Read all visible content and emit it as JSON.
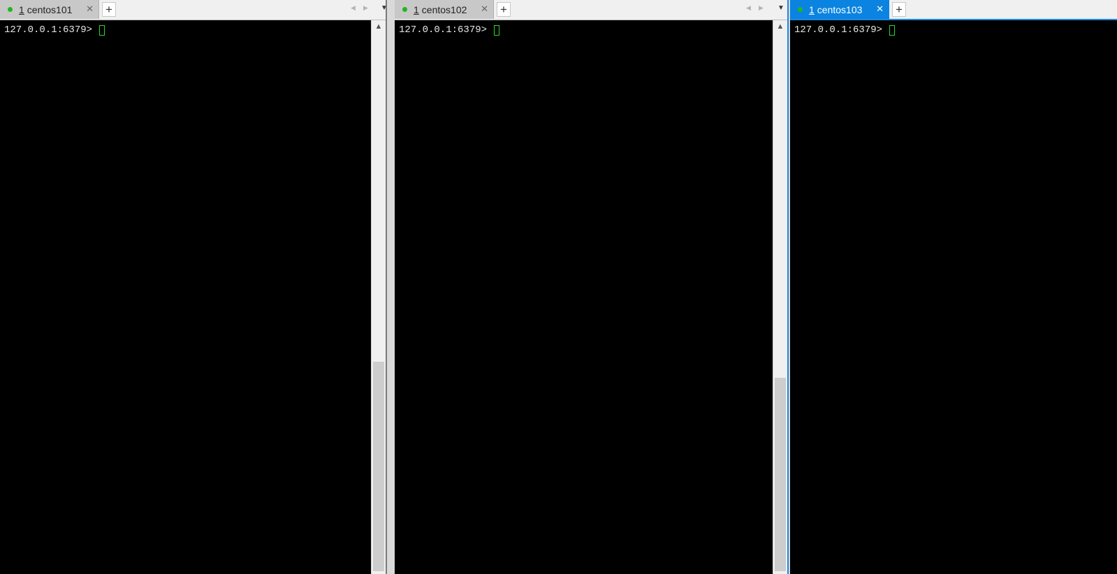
{
  "panes": [
    {
      "tab": {
        "number": "1",
        "label": "centos101"
      },
      "terminal": {
        "prompt": "127.0.0.1:6379> "
      }
    },
    {
      "tab": {
        "number": "1",
        "label": "centos102"
      },
      "terminal": {
        "prompt": "127.0.0.1:6379> "
      }
    },
    {
      "tab": {
        "number": "1",
        "label": "centos103"
      },
      "terminal": {
        "prompt": "127.0.0.1:6379> "
      }
    }
  ],
  "icons": {
    "status": "status-dot-icon",
    "close": "close-icon",
    "add": "plus-icon",
    "scroll_left": "arrow-left-icon",
    "scroll_right": "arrow-right-icon",
    "menu": "chevron-down-icon",
    "scroll_up": "chevron-up-icon"
  },
  "colors": {
    "terminal_bg": "#000000",
    "terminal_text": "#e8e8e8",
    "cursor": "#2bd62b",
    "active_tab": "#0a84e0",
    "inactive_tab": "#c8c8c8",
    "status_dot": "#22b522"
  }
}
